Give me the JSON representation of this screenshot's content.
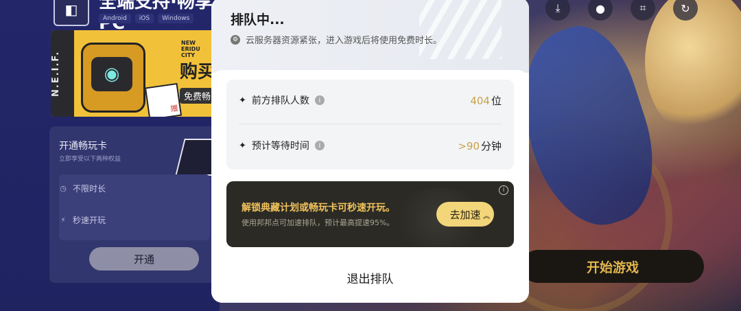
{
  "top_icons": [
    "download-icon",
    "user-icon",
    "scan-icon",
    "refresh-icon"
  ],
  "left_panel": {
    "support_title": "全端支持·畅享PC",
    "platforms": [
      "Android",
      "iOS",
      "Windows"
    ],
    "banner": {
      "strip_text": "N.E.I.F.",
      "city_text": "NEW ERIDU CITY",
      "buy_text": "购买",
      "free_text": "免费畅",
      "gift_text": "赠"
    },
    "card": {
      "title": "开通畅玩卡",
      "subtitle": "立即享受以下两种权益",
      "benefits": [
        "不限时长",
        "秒速开玩"
      ],
      "open_button": "开通"
    }
  },
  "start_button": "开始游戏",
  "modal": {
    "title": "排队中...",
    "notice": "云服务器资源紧张，进入游戏后将使用免费时长。",
    "queue_label": "前方排队人数",
    "queue_value": "404",
    "queue_unit": "位",
    "wait_label": "预计等待时间",
    "wait_value": ">90",
    "wait_unit": "分钟",
    "promo_title": "解锁典藏计划或畅玩卡可秒速开玩。",
    "promo_subtitle": "使用邦邦点可加速排队，预计最高提速95%。",
    "promo_button": "去加速",
    "exit_button": "退出排队"
  },
  "colors": {
    "accent_gold": "#c9a24a",
    "promo_bg": "#2b2a24",
    "promo_button": "#f3d57a",
    "start_text": "#e2b64c"
  }
}
